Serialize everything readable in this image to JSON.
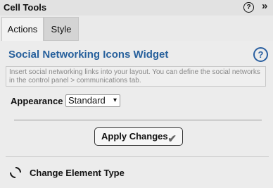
{
  "header": {
    "title": "Cell Tools",
    "help_glyph": "?",
    "expand_glyph": "»"
  },
  "tabs": [
    {
      "label": "Actions",
      "active": true
    },
    {
      "label": "Style",
      "active": false
    }
  ],
  "widget": {
    "title": "Social Networking Icons Widget",
    "help_glyph": "?",
    "description": "Insert social networking links into your layout. You can define the social networks in the control panel > communications tab."
  },
  "appearance": {
    "label": "Appearance",
    "selected": "Standard",
    "chevron": "▾"
  },
  "actions": {
    "apply_label": "Apply Changes",
    "apply_icon": "check-icon",
    "change_type_label": "Change Element Type",
    "change_type_icon": "refresh-icon"
  },
  "colors": {
    "accent": "#27609c",
    "background": "#ececec"
  }
}
